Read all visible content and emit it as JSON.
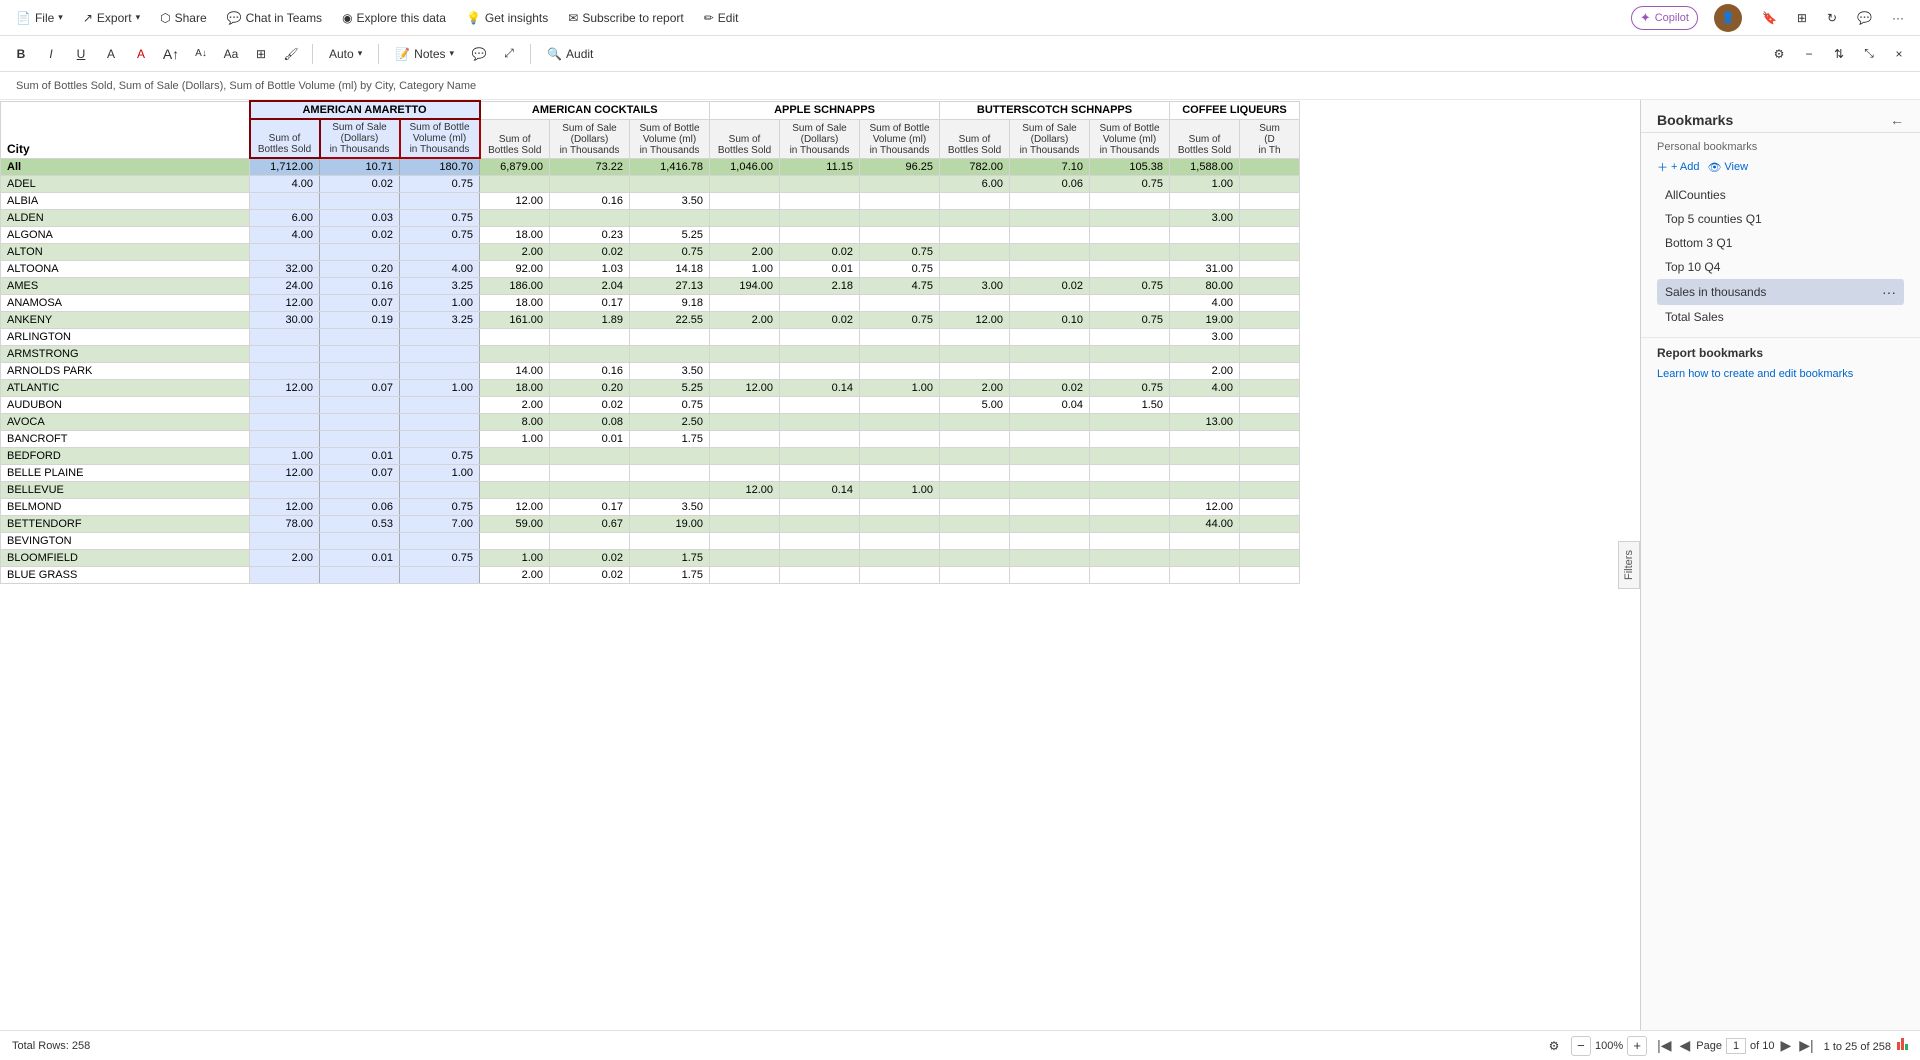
{
  "topbar": {
    "file": "File",
    "export": "Export",
    "share": "Share",
    "chat_teams": "Chat in Teams",
    "explore": "Explore this data",
    "insights": "Get insights",
    "subscribe": "Subscribe to report",
    "edit": "Edit"
  },
  "formatbar": {
    "bold": "B",
    "italic": "I",
    "underline": "U",
    "auto": "Auto",
    "notes": "Notes",
    "audit": "Audit"
  },
  "desc": "Sum of Bottles Sold, Sum of Sale (Dollars), Sum of Bottle Volume (ml) by City, Category Name",
  "filters_label": "Filters",
  "table": {
    "city_header": "City",
    "categories": [
      {
        "name": "AMERICAN AMARETTO",
        "cols": [
          "Sum of Bottles Sold",
          "Sum of Sale (Dollars) in Thousands",
          "Sum of Bottle Volume (ml) in Thousands"
        ]
      },
      {
        "name": "AMERICAN COCKTAILS",
        "cols": [
          "Sum of Bottles Sold",
          "Sum of Sale (Dollars) in Thousands",
          "Sum of Bottle Volume (ml) in Thousands"
        ]
      },
      {
        "name": "APPLE SCHNAPPS",
        "cols": [
          "Sum of Bottles Sold",
          "Sum of Sale (Dollars) in Thousands",
          "Sum of Bottle Volume (ml) in Thousands"
        ]
      },
      {
        "name": "BUTTERSCOTCH SCHNAPPS",
        "cols": [
          "Sum of Bottles Sold",
          "Sum of Sale (Dollars) in Thousands",
          "Sum of Bottle Volume (ml) in Thousands"
        ]
      },
      {
        "name": "COFFEE LIQUEURS",
        "cols": [
          "Sum of Bottles Sold",
          "Sum of (D in Th"
        ]
      }
    ],
    "col_labels": {
      "sum_bottles": "Sum of\nBottles Sold",
      "sum_sale": "Sum of Sale\n(Dollars)\nin Thousands",
      "sum_volume": "Sum of Bottle\nVolume (ml)\nin Thousands"
    },
    "rows": [
      {
        "city": "All",
        "aa_b": "1,712.00",
        "aa_s": "10.71",
        "aa_v": "180.70",
        "ac_b": "6,879.00",
        "ac_s": "73.22",
        "ac_v": "1,416.78",
        "as_b": "1,046.00",
        "as_s": "11.15",
        "as_v": "96.25",
        "bs_b": "782.00",
        "bs_s": "7.10",
        "bs_v": "105.38",
        "cl_b": "1,588.00",
        "cl_s": "",
        "type": "all"
      },
      {
        "city": "ADEL",
        "aa_b": "4.00",
        "aa_s": "0.02",
        "aa_v": "0.75",
        "ac_b": "",
        "ac_s": "",
        "ac_v": "",
        "as_b": "",
        "as_s": "",
        "as_v": "",
        "bs_b": "6.00",
        "bs_s": "0.06",
        "bs_v": "0.75",
        "cl_b": "1.00",
        "cl_s": "",
        "type": "odd"
      },
      {
        "city": "ALBIA",
        "aa_b": "",
        "aa_s": "",
        "aa_v": "",
        "ac_b": "12.00",
        "ac_s": "0.16",
        "ac_v": "3.50",
        "as_b": "",
        "as_s": "",
        "as_v": "",
        "bs_b": "",
        "bs_s": "",
        "bs_v": "",
        "cl_b": "",
        "cl_s": "",
        "type": "even"
      },
      {
        "city": "ALDEN",
        "aa_b": "6.00",
        "aa_s": "0.03",
        "aa_v": "0.75",
        "ac_b": "",
        "ac_s": "",
        "ac_v": "",
        "as_b": "",
        "as_s": "",
        "as_v": "",
        "bs_b": "",
        "bs_s": "",
        "bs_v": "",
        "cl_b": "3.00",
        "cl_s": "",
        "type": "odd"
      },
      {
        "city": "ALGONA",
        "aa_b": "4.00",
        "aa_s": "0.02",
        "aa_v": "0.75",
        "ac_b": "18.00",
        "ac_s": "0.23",
        "ac_v": "5.25",
        "as_b": "",
        "as_s": "",
        "as_v": "",
        "bs_b": "",
        "bs_s": "",
        "bs_v": "",
        "cl_b": "",
        "cl_s": "",
        "type": "even"
      },
      {
        "city": "ALTON",
        "aa_b": "",
        "aa_s": "",
        "aa_v": "",
        "ac_b": "2.00",
        "ac_s": "0.02",
        "ac_v": "0.75",
        "as_b": "2.00",
        "as_s": "0.02",
        "as_v": "0.75",
        "bs_b": "",
        "bs_s": "",
        "bs_v": "",
        "cl_b": "",
        "cl_s": "",
        "type": "odd"
      },
      {
        "city": "ALTOONA",
        "aa_b": "32.00",
        "aa_s": "0.20",
        "aa_v": "4.00",
        "ac_b": "92.00",
        "ac_s": "1.03",
        "ac_v": "14.18",
        "as_b": "1.00",
        "as_s": "0.01",
        "as_v": "0.75",
        "bs_b": "",
        "bs_s": "",
        "bs_v": "",
        "cl_b": "31.00",
        "cl_s": "",
        "type": "even"
      },
      {
        "city": "AMES",
        "aa_b": "24.00",
        "aa_s": "0.16",
        "aa_v": "3.25",
        "ac_b": "186.00",
        "ac_s": "2.04",
        "ac_v": "27.13",
        "as_b": "194.00",
        "as_s": "2.18",
        "as_v": "4.75",
        "bs_b": "3.00",
        "bs_s": "0.02",
        "bs_v": "0.75",
        "cl_b": "80.00",
        "cl_s": "",
        "type": "odd"
      },
      {
        "city": "ANAMOSA",
        "aa_b": "12.00",
        "aa_s": "0.07",
        "aa_v": "1.00",
        "ac_b": "18.00",
        "ac_s": "0.17",
        "ac_v": "9.18",
        "as_b": "",
        "as_s": "",
        "as_v": "",
        "bs_b": "",
        "bs_s": "",
        "bs_v": "",
        "cl_b": "4.00",
        "cl_s": "",
        "type": "even"
      },
      {
        "city": "ANKENY",
        "aa_b": "30.00",
        "aa_s": "0.19",
        "aa_v": "3.25",
        "ac_b": "161.00",
        "ac_s": "1.89",
        "ac_v": "22.55",
        "as_b": "2.00",
        "as_s": "0.02",
        "as_v": "0.75",
        "bs_b": "12.00",
        "bs_s": "0.10",
        "bs_v": "0.75",
        "cl_b": "19.00",
        "cl_s": "",
        "type": "odd"
      },
      {
        "city": "ARLINGTON",
        "aa_b": "",
        "aa_s": "",
        "aa_v": "",
        "ac_b": "",
        "ac_s": "",
        "ac_v": "",
        "as_b": "",
        "as_s": "",
        "as_v": "",
        "bs_b": "",
        "bs_s": "",
        "bs_v": "",
        "cl_b": "3.00",
        "cl_s": "",
        "type": "even"
      },
      {
        "city": "ARMSTRONG",
        "aa_b": "",
        "aa_s": "",
        "aa_v": "",
        "ac_b": "",
        "ac_s": "",
        "ac_v": "",
        "as_b": "",
        "as_s": "",
        "as_v": "",
        "bs_b": "",
        "bs_s": "",
        "bs_v": "",
        "cl_b": "",
        "cl_s": "",
        "type": "odd"
      },
      {
        "city": "ARNOLDS PARK",
        "aa_b": "",
        "aa_s": "",
        "aa_v": "",
        "ac_b": "14.00",
        "ac_s": "0.16",
        "ac_v": "3.50",
        "as_b": "",
        "as_s": "",
        "as_v": "",
        "bs_b": "",
        "bs_s": "",
        "bs_v": "",
        "cl_b": "2.00",
        "cl_s": "",
        "type": "even"
      },
      {
        "city": "ATLANTIC",
        "aa_b": "12.00",
        "aa_s": "0.07",
        "aa_v": "1.00",
        "ac_b": "18.00",
        "ac_s": "0.20",
        "ac_v": "5.25",
        "as_b": "12.00",
        "as_s": "0.14",
        "as_v": "1.00",
        "bs_b": "2.00",
        "bs_s": "0.02",
        "bs_v": "0.75",
        "cl_b": "4.00",
        "cl_s": "",
        "type": "odd"
      },
      {
        "city": "AUDUBON",
        "aa_b": "",
        "aa_s": "",
        "aa_v": "",
        "ac_b": "2.00",
        "ac_s": "0.02",
        "ac_v": "0.75",
        "as_b": "",
        "as_s": "",
        "as_v": "",
        "bs_b": "5.00",
        "bs_s": "0.04",
        "bs_v": "1.50",
        "cl_b": "",
        "cl_s": "",
        "type": "even"
      },
      {
        "city": "AVOCA",
        "aa_b": "",
        "aa_s": "",
        "aa_v": "",
        "ac_b": "8.00",
        "ac_s": "0.08",
        "ac_v": "2.50",
        "as_b": "",
        "as_s": "",
        "as_v": "",
        "bs_b": "",
        "bs_s": "",
        "bs_v": "",
        "cl_b": "13.00",
        "cl_s": "",
        "type": "odd"
      },
      {
        "city": "BANCROFT",
        "aa_b": "",
        "aa_s": "",
        "aa_v": "",
        "ac_b": "1.00",
        "ac_s": "0.01",
        "ac_v": "1.75",
        "as_b": "",
        "as_s": "",
        "as_v": "",
        "bs_b": "",
        "bs_s": "",
        "bs_v": "",
        "cl_b": "",
        "cl_s": "",
        "type": "even"
      },
      {
        "city": "BEDFORD",
        "aa_b": "1.00",
        "aa_s": "0.01",
        "aa_v": "0.75",
        "ac_b": "",
        "ac_s": "",
        "ac_v": "",
        "as_b": "",
        "as_s": "",
        "as_v": "",
        "bs_b": "",
        "bs_s": "",
        "bs_v": "",
        "cl_b": "",
        "cl_s": "",
        "type": "odd"
      },
      {
        "city": "BELLE PLAINE",
        "aa_b": "12.00",
        "aa_s": "0.07",
        "aa_v": "1.00",
        "ac_b": "",
        "ac_s": "",
        "ac_v": "",
        "as_b": "",
        "as_s": "",
        "as_v": "",
        "bs_b": "",
        "bs_s": "",
        "bs_v": "",
        "cl_b": "",
        "cl_s": "",
        "type": "even"
      },
      {
        "city": "BELLEVUE",
        "aa_b": "",
        "aa_s": "",
        "aa_v": "",
        "ac_b": "",
        "ac_s": "",
        "ac_v": "",
        "as_b": "12.00",
        "as_s": "0.14",
        "as_v": "1.00",
        "bs_b": "",
        "bs_s": "",
        "bs_v": "",
        "cl_b": "",
        "cl_s": "",
        "type": "odd"
      },
      {
        "city": "BELMOND",
        "aa_b": "12.00",
        "aa_s": "0.06",
        "aa_v": "0.75",
        "ac_b": "12.00",
        "ac_s": "0.17",
        "ac_v": "3.50",
        "as_b": "",
        "as_s": "",
        "as_v": "",
        "bs_b": "",
        "bs_s": "",
        "bs_v": "",
        "cl_b": "12.00",
        "cl_s": "",
        "type": "even"
      },
      {
        "city": "BETTENDORF",
        "aa_b": "78.00",
        "aa_s": "0.53",
        "aa_v": "7.00",
        "ac_b": "59.00",
        "ac_s": "0.67",
        "ac_v": "19.00",
        "as_b": "",
        "as_s": "",
        "as_v": "",
        "bs_b": "",
        "bs_s": "",
        "bs_v": "",
        "cl_b": "44.00",
        "cl_s": "",
        "type": "odd"
      },
      {
        "city": "BEVINGTON",
        "aa_b": "",
        "aa_s": "",
        "aa_v": "",
        "ac_b": "",
        "ac_s": "",
        "ac_v": "",
        "as_b": "",
        "as_s": "",
        "as_v": "",
        "bs_b": "",
        "bs_s": "",
        "bs_v": "",
        "cl_b": "",
        "cl_s": "",
        "type": "even"
      },
      {
        "city": "BLOOMFIELD",
        "aa_b": "2.00",
        "aa_s": "0.01",
        "aa_v": "0.75",
        "ac_b": "1.00",
        "ac_s": "0.02",
        "ac_v": "1.75",
        "as_b": "",
        "as_s": "",
        "as_v": "",
        "bs_b": "",
        "bs_s": "",
        "bs_v": "",
        "cl_b": "",
        "cl_s": "",
        "type": "odd"
      },
      {
        "city": "BLUE GRASS",
        "aa_b": "",
        "aa_s": "",
        "aa_v": "",
        "ac_b": "2.00",
        "ac_s": "0.02",
        "ac_v": "1.75",
        "as_b": "",
        "as_s": "",
        "as_v": "",
        "bs_b": "",
        "bs_s": "",
        "bs_v": "",
        "cl_b": "",
        "cl_s": "",
        "type": "even"
      }
    ]
  },
  "sidebar": {
    "title": "Bookmarks",
    "personal_title": "Personal bookmarks",
    "add_label": "+ Add",
    "view_label": "View",
    "bookmarks": [
      {
        "label": "AllCounties",
        "active": false
      },
      {
        "label": "Top 5 counties Q1",
        "active": false
      },
      {
        "label": "Bottom 3 Q1",
        "active": false
      },
      {
        "label": "Top 10 Q4",
        "active": false
      },
      {
        "label": "Sales in thousands",
        "active": true
      },
      {
        "label": "Total Sales",
        "active": false
      }
    ],
    "report_bookmarks_title": "Report bookmarks",
    "learn_link": "Learn how to create and edit bookmarks"
  },
  "bottombar": {
    "total_rows": "Total Rows: 258",
    "zoom": "100%",
    "page_label": "Page",
    "page_current": "1",
    "page_of": "of 10",
    "records": "1 to 25 of 258"
  }
}
